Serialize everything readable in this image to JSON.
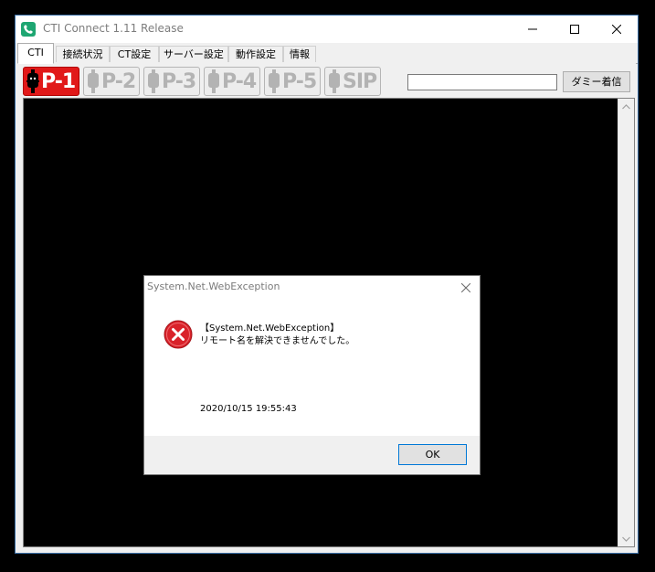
{
  "window": {
    "title": "CTI Connect 1.11 Release"
  },
  "tabs": [
    {
      "label": "CTI",
      "active": true
    },
    {
      "label": "接続状況"
    },
    {
      "label": "CT設定"
    },
    {
      "label": "サーバー設定"
    },
    {
      "label": "動作設定"
    },
    {
      "label": "情報"
    }
  ],
  "phone_buttons": [
    {
      "label": "P-1",
      "state": "active"
    },
    {
      "label": "P-2",
      "state": "inactive"
    },
    {
      "label": "P-3",
      "state": "inactive"
    },
    {
      "label": "P-4",
      "state": "inactive"
    },
    {
      "label": "P-5",
      "state": "inactive"
    },
    {
      "label": "SIP",
      "state": "inactive"
    }
  ],
  "toolbar": {
    "dummy_input_value": "",
    "dummy_call_label": "ダミー着信"
  },
  "dialog": {
    "title": "System.Net.WebException",
    "message_line1": "【System.Net.WebException】",
    "message_line2": "リモート名を解決できませんでした。",
    "timestamp": "2020/10/15 19:55:43",
    "ok_label": "OK",
    "icon": "error-icon"
  },
  "colors": {
    "active_button": "#e11919",
    "inactive_text": "#b3b3b3",
    "app_icon": "#1ea672",
    "error_red": "#d9222a"
  }
}
